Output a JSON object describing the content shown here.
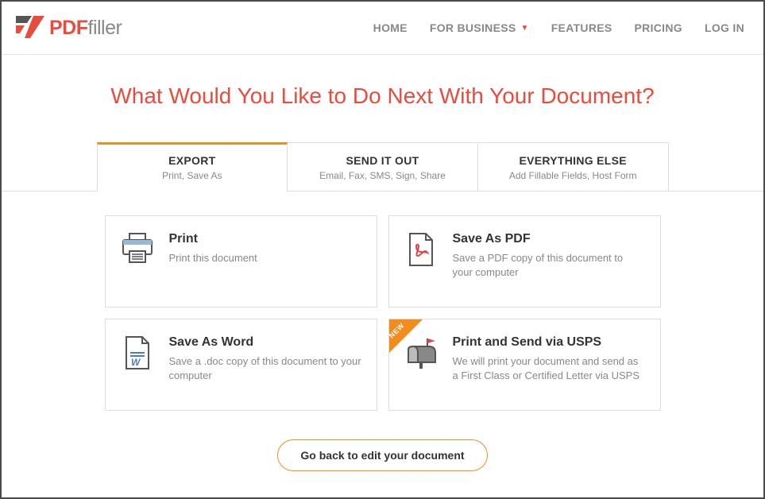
{
  "header": {
    "logo_pdf": "PDF",
    "logo_filler": "filler",
    "nav": {
      "home": "HOME",
      "business": "FOR BUSINESS",
      "features": "FEATURES",
      "pricing": "PRICING",
      "login": "LOG IN"
    }
  },
  "title": "What Would You Like to Do Next With Your Document?",
  "tabs": [
    {
      "label": "EXPORT",
      "sub": "Print, Save As"
    },
    {
      "label": "SEND IT OUT",
      "sub": "Email, Fax, SMS, Sign, Share"
    },
    {
      "label": "EVERYTHING ELSE",
      "sub": "Add Fillable Fields, Host Form"
    }
  ],
  "cards": [
    {
      "title": "Print",
      "desc": "Print this document"
    },
    {
      "title": "Save As PDF",
      "desc": "Save a PDF copy of this document to your computer"
    },
    {
      "title": "Save As Word",
      "desc": "Save a .doc copy of this document to your computer"
    },
    {
      "title": "Print and Send via USPS",
      "desc": "We will print your document and send as a First Class or Certified Letter via USPS",
      "ribbon": "NEW"
    }
  ],
  "back_button": "Go back to edit your document"
}
